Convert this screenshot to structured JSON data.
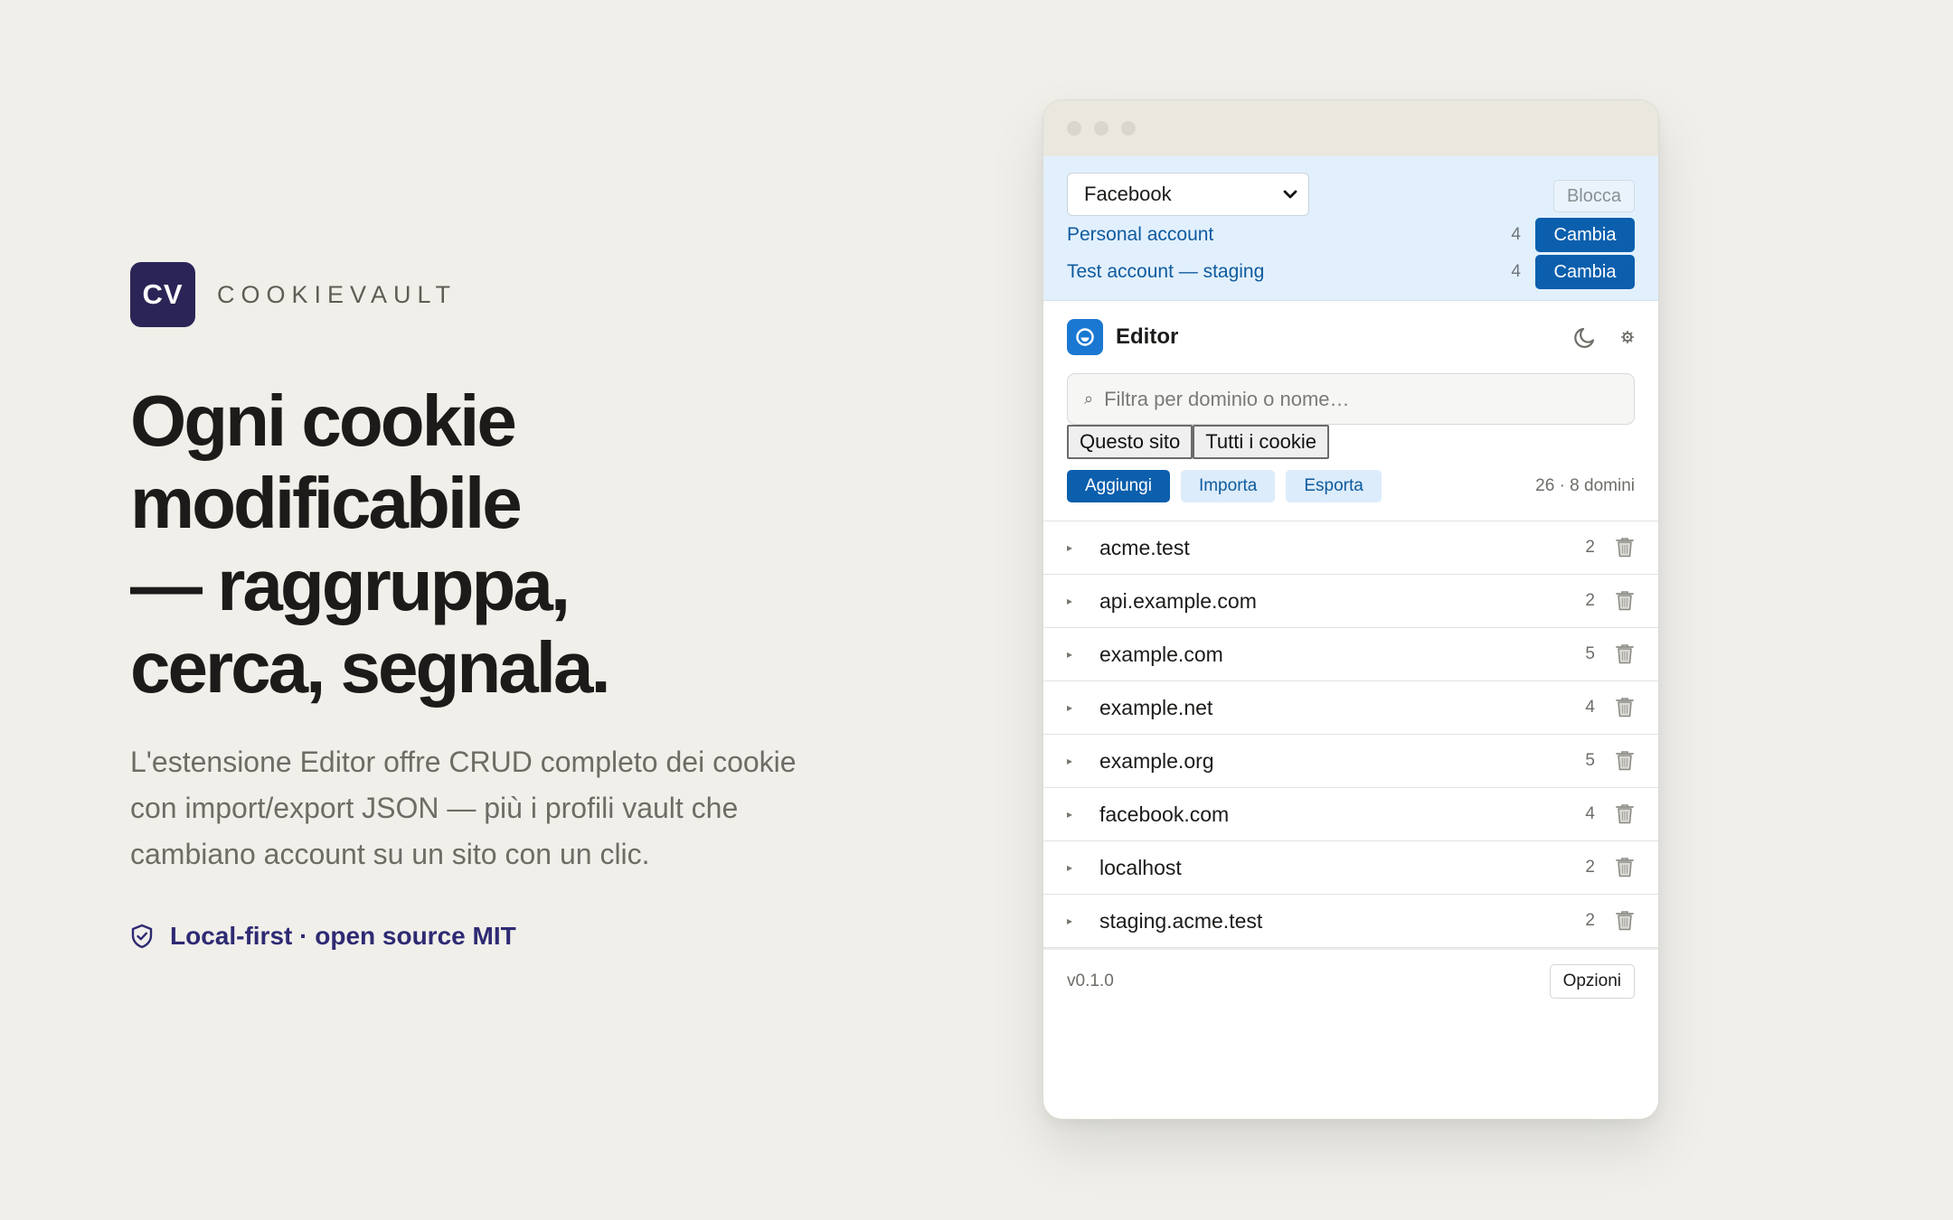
{
  "brand": {
    "logo_text": "CV",
    "name": "COOKIEVAULT"
  },
  "hero": {
    "headline_lines": [
      "Ogni cookie",
      "modificabile",
      "— raggruppa,",
      "cerca, segnala."
    ],
    "lede": "L'estensione Editor offre CRUD completo dei cookie con import/export JSON — più i profili vault che cambiano account su un sito con un clic.",
    "badge": "Local-first · open source MIT",
    "badge_icon": "shield-check-icon"
  },
  "colors": {
    "background": "#f0efea",
    "brand": "#2b2557",
    "accent": "#0b5fad",
    "vault_panel": "#e2f0fd"
  },
  "vault": {
    "site_select": "Facebook",
    "block_label": "Blocca",
    "accounts": [
      {
        "name": "Personal account",
        "count": "4",
        "action": "Cambia"
      },
      {
        "name": "Test account — staging",
        "count": "4",
        "action": "Cambia"
      }
    ]
  },
  "editor": {
    "title": "Editor",
    "icons": [
      "moon-icon",
      "gear-icon"
    ],
    "search_placeholder": "Filtra per dominio o nome…",
    "scope_tabs": [
      "Questo sito",
      "Tutti i cookie"
    ],
    "actions": {
      "add": "Aggiungi",
      "import": "Importa",
      "export": "Esporta"
    },
    "summary": "26 · 8 domini",
    "domains": [
      {
        "name": "acme.test",
        "count": "2"
      },
      {
        "name": "api.example.com",
        "count": "2"
      },
      {
        "name": "example.com",
        "count": "5"
      },
      {
        "name": "example.net",
        "count": "4"
      },
      {
        "name": "example.org",
        "count": "5"
      },
      {
        "name": "facebook.com",
        "count": "4"
      },
      {
        "name": "localhost",
        "count": "2"
      },
      {
        "name": "staging.acme.test",
        "count": "2"
      }
    ]
  },
  "footer": {
    "version": "v0.1.0",
    "options": "Opzioni"
  }
}
